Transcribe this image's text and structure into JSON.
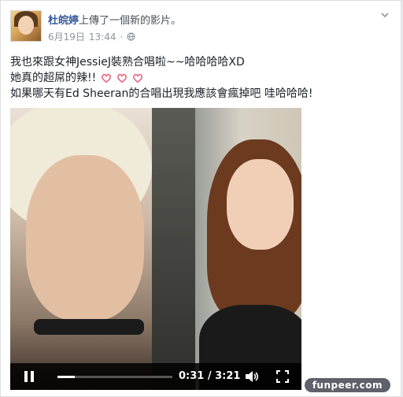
{
  "post": {
    "author": "杜皖婷",
    "action": "上傳了一個新的影片。",
    "date": "6月19日",
    "time": "13:44",
    "separator": "·",
    "privacy_icon": "globe-icon",
    "menu_icon": "chevron-down-icon"
  },
  "caption": {
    "line1": "我也來跟女神JessieJ裝熟合唱啦~~哈哈哈哈XD",
    "line2": "她真的超屌的辣!!",
    "line3": "如果哪天有Ed Sheeran的合唱出現我應該會瘋掉吧 哇哈哈哈!",
    "heart_count": 3,
    "heart_color": "#e9546b"
  },
  "video": {
    "current_time": "0:31",
    "duration": "3:21",
    "timecode": "0:31 / 3:21",
    "progress_fraction": 0.154,
    "play_icon": "pause-icon",
    "volume_icon": "volume-icon",
    "fullscreen_icon": "fullscreen-icon"
  },
  "watermark": "funpeer.com",
  "colors": {
    "link": "#365899",
    "meta": "#90949c",
    "text": "#1d2129"
  }
}
